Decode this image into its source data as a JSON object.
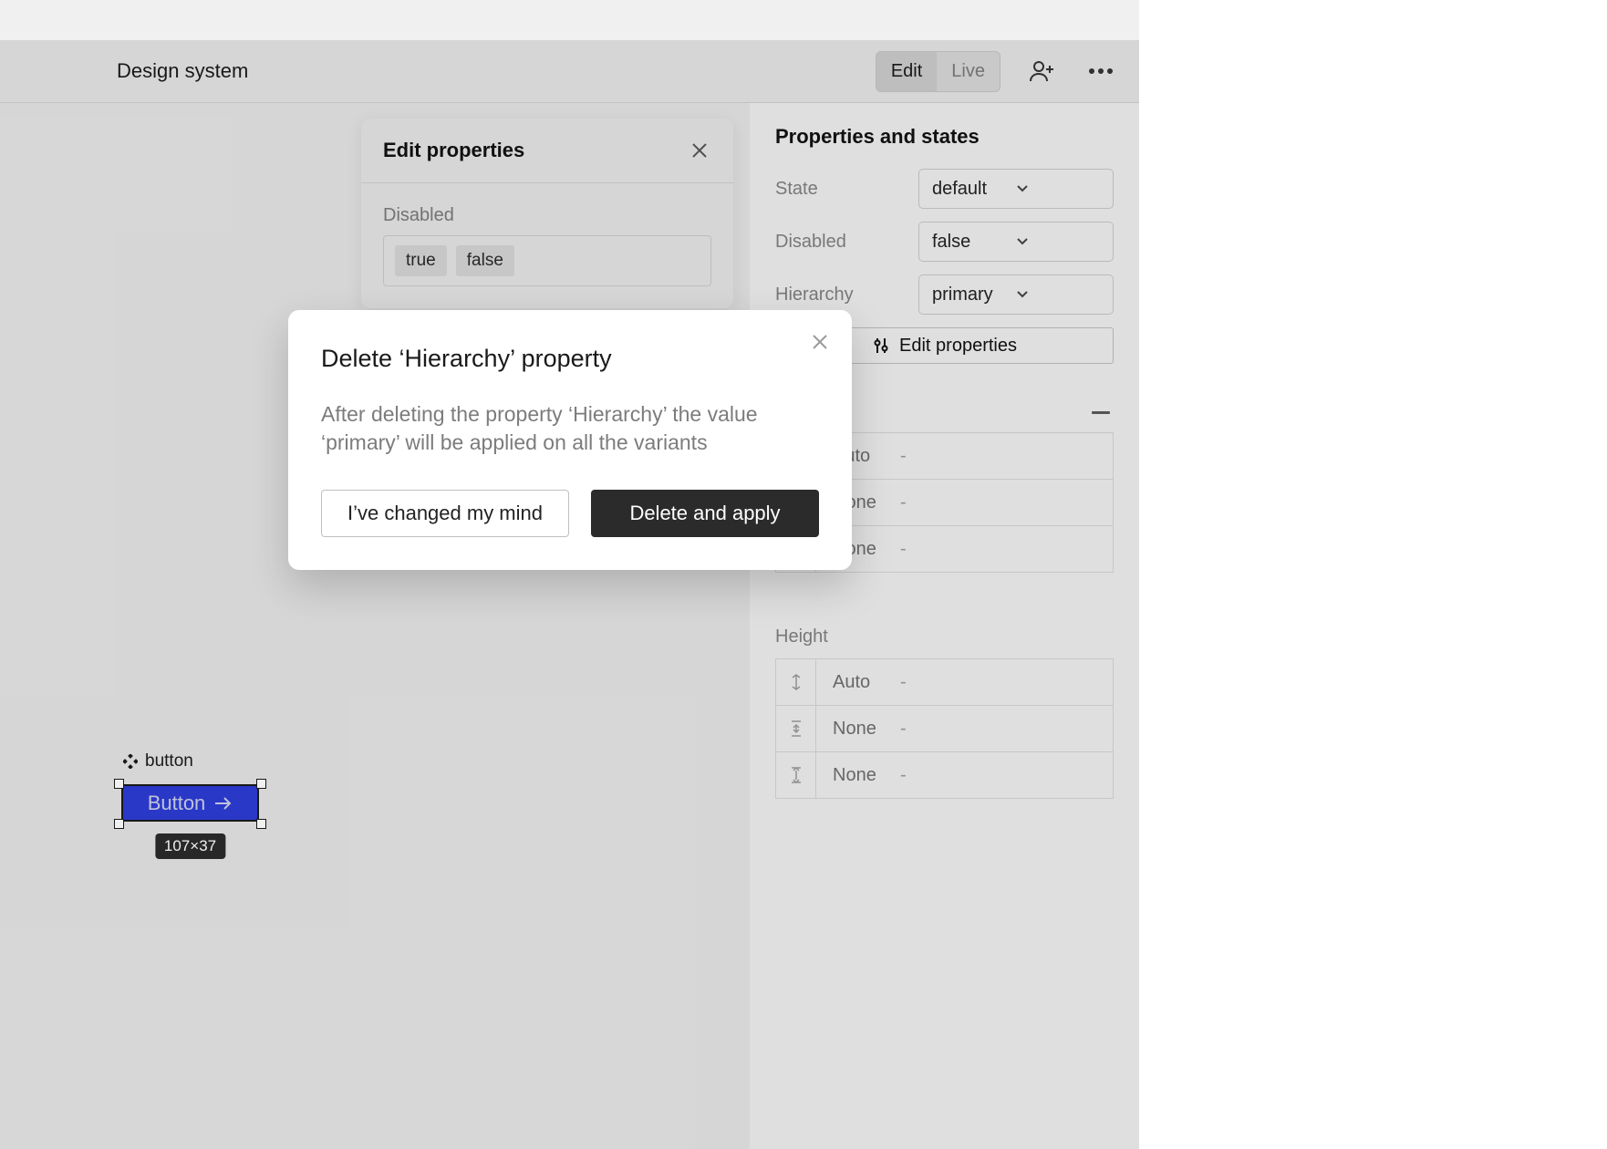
{
  "topbar": {
    "title": "Design system",
    "mode_edit": "Edit",
    "mode_live": "Live"
  },
  "canvas": {
    "selected": {
      "element_label": "button",
      "text": "Button",
      "dimensions": "107×37"
    }
  },
  "float_panel": {
    "title": "Edit properties",
    "prop_label": "Disabled",
    "options": {
      "true": "true",
      "false": "false"
    }
  },
  "rightpanel": {
    "heading": "Properties and states",
    "props": {
      "state": {
        "label": "State",
        "value": "default"
      },
      "disabled": {
        "label": "Disabled",
        "value": "false"
      },
      "hierarchy": {
        "label": "Hierarchy",
        "value": "primary"
      }
    },
    "edit_btn": "Edit properties",
    "width_label": "Height",
    "dims": {
      "w_auto": "Auto",
      "w_min": "None",
      "w_max": "None",
      "h_auto": "Auto",
      "h_min": "None",
      "h_max": "None",
      "dash": "-"
    }
  },
  "dialog": {
    "title": "Delete ‘Hierarchy’ property",
    "body": "After deleting the property ‘Hierarchy’ the value ‘primary’ will be applied on all the variants",
    "cancel": "I’ve changed my mind",
    "confirm": "Delete and apply"
  }
}
